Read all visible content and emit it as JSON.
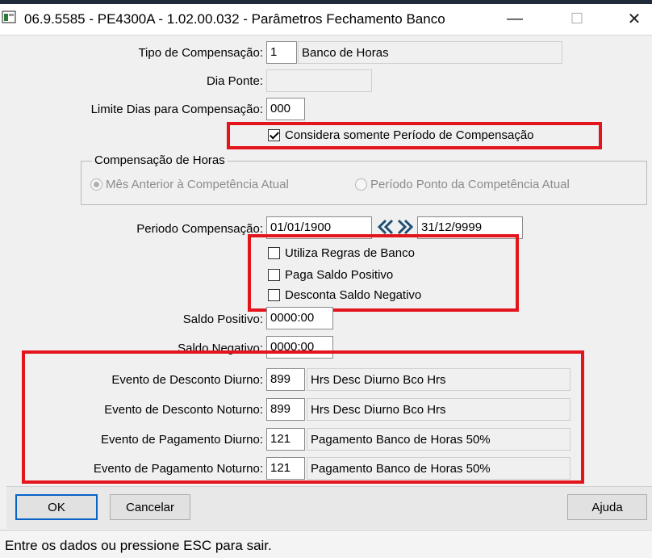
{
  "window": {
    "title": "06.9.5585 - PE4300A - 1.02.00.032 - Parâmetros Fechamento Banco",
    "minimize": "—",
    "maximize": "☐",
    "close": "✕"
  },
  "form": {
    "tipo_compensacao": {
      "label": "Tipo de Compensação:",
      "code": "1",
      "desc": "Banco de Horas"
    },
    "dia_ponte": {
      "label": "Dia Ponte:",
      "value": ""
    },
    "limite_dias": {
      "label": "Limite Dias para Compensação:",
      "value": "000"
    },
    "considera_periodo": {
      "label": "Considera somente Período de Compensação",
      "checked": true
    },
    "compensacao_horas": {
      "title": "Compensação de Horas",
      "options": [
        {
          "label": "Mês Anterior à Competência Atual",
          "selected": true
        },
        {
          "label": "Período Ponto da Competência Atual",
          "selected": false
        }
      ]
    },
    "periodo_compensacao": {
      "label": "Periodo Compensação:",
      "start": "01/01/1900",
      "end": "31/12/9999"
    },
    "checkboxes": [
      {
        "label": "Utiliza Regras de Banco",
        "checked": false
      },
      {
        "label": "Paga Saldo Positivo",
        "checked": false
      },
      {
        "label": "Desconta Saldo Negativo",
        "checked": false
      }
    ],
    "saldo_positivo": {
      "label": "Saldo Positivo:",
      "value": "0000:00"
    },
    "saldo_negativo": {
      "label": "Saldo Negativo:",
      "value": "0000:00"
    },
    "eventos": [
      {
        "label": "Evento de Desconto Diurno:",
        "code": "899",
        "desc": "Hrs Desc Diurno Bco Hrs"
      },
      {
        "label": "Evento de Desconto Noturno:",
        "code": "899",
        "desc": "Hrs Desc Diurno Bco Hrs"
      },
      {
        "label": "Evento de Pagamento Diurno:",
        "code": "121",
        "desc": "Pagamento Banco de Horas 50%"
      },
      {
        "label": "Evento de Pagamento Noturno:",
        "code": "121",
        "desc": "Pagamento Banco de Horas 50%"
      }
    ]
  },
  "buttons": {
    "ok": "OK",
    "cancel": "Cancelar",
    "help": "Ajuda"
  },
  "status": "Entre os dados ou pressione ESC para sair.",
  "colors": {
    "highlight": "#e3141b",
    "default_button_border": "#0a64c8"
  }
}
